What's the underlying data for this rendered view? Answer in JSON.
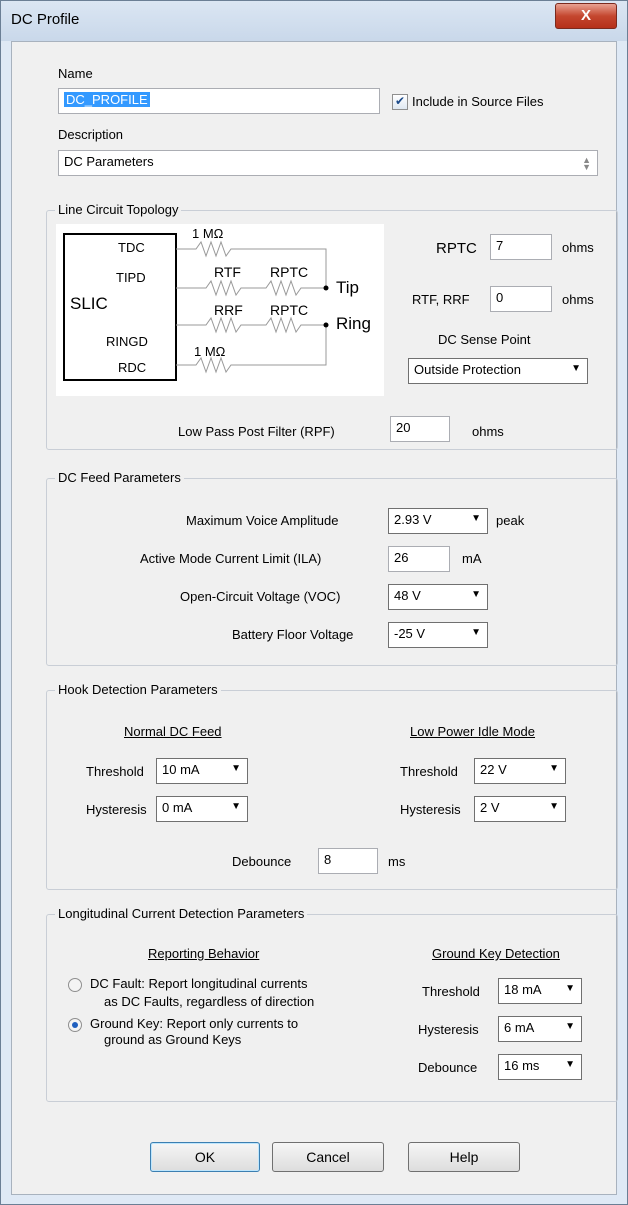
{
  "window": {
    "title": "DC Profile",
    "close_glyph": "X"
  },
  "name": {
    "label": "Name",
    "value": "DC_PROFILE"
  },
  "include_in_source": {
    "label": "Include in Source Files",
    "checked": true
  },
  "description": {
    "label": "Description",
    "value": "DC Parameters"
  },
  "topology": {
    "title": "Line Circuit Topology",
    "diagram": {
      "slic": "SLIC",
      "tdc": "TDC",
      "tipd": "TIPD",
      "ringd": "RINGD",
      "rdc": "RDC",
      "r_top": "1 MΩ",
      "r_bottom": "1 MΩ",
      "rtf": "RTF",
      "rptc_tip": "RPTC",
      "rrf": "RRF",
      "rptc_ring": "RPTC",
      "tip": "Tip",
      "ring": "Ring"
    },
    "rptc": {
      "label": "RPTC",
      "value": "7",
      "unit": "ohms"
    },
    "rtf_rrf": {
      "label": "RTF, RRF",
      "value": "0",
      "unit": "ohms"
    },
    "sense_point": {
      "label": "DC Sense Point",
      "value": "Outside Protection"
    },
    "low_pass": {
      "label": "Low Pass Post Filter (RPF)",
      "value": "20",
      "unit": "ohms"
    }
  },
  "dc_feed": {
    "title": "DC Feed Parameters",
    "max_voice": {
      "label": "Maximum Voice Amplitude",
      "value": "2.93 V",
      "unit": "peak"
    },
    "ila": {
      "label": "Active Mode Current Limit (ILA)",
      "value": "26",
      "unit": "mA"
    },
    "voc": {
      "label": "Open-Circuit Voltage (VOC)",
      "value": "48 V"
    },
    "battery": {
      "label": "Battery Floor Voltage",
      "value": "-25 V"
    }
  },
  "hook": {
    "title": "Hook Detection Parameters",
    "normal_heading": "Normal DC Feed",
    "lowpower_heading": "Low Power Idle Mode",
    "threshold_label": "Threshold",
    "hysteresis_label": "Hysteresis",
    "normal_threshold": "10 mA",
    "normal_hysteresis": "0 mA",
    "lp_threshold": "22 V",
    "lp_hysteresis": "2 V",
    "debounce": {
      "label": "Debounce",
      "value": "8",
      "unit": "ms"
    }
  },
  "longitudinal": {
    "title": "Longitudinal Current Detection Parameters",
    "reporting_heading": "Reporting Behavior",
    "gk_heading": "Ground Key Detection",
    "opt_dc_fault_1": "DC Fault: Report longitudinal currents",
    "opt_dc_fault_2": "as DC Faults, regardless of direction",
    "opt_ground_key_1": "Ground Key: Report only currents to",
    "opt_ground_key_2": "ground as Ground Keys",
    "selected": "ground_key",
    "threshold_label": "Threshold",
    "hysteresis_label": "Hysteresis",
    "debounce_label": "Debounce",
    "threshold": "18 mA",
    "hysteresis": "6 mA",
    "debounce": "16 ms"
  },
  "buttons": {
    "ok": "OK",
    "cancel": "Cancel",
    "help": "Help"
  },
  "icons": {
    "dropdown": "chevron-down-icon",
    "check": "check-icon",
    "close": "close-icon"
  }
}
